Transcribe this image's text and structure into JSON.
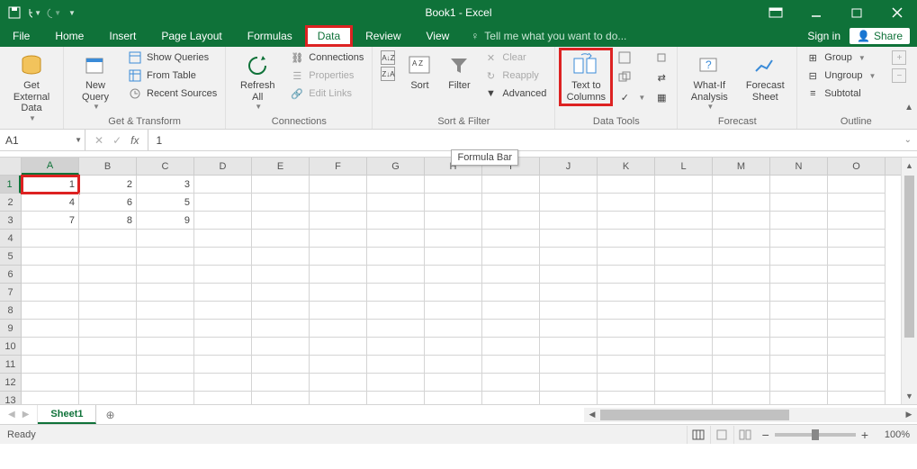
{
  "title": "Book1 - Excel",
  "tabs": [
    "File",
    "Home",
    "Insert",
    "Page Layout",
    "Formulas",
    "Data",
    "Review",
    "View"
  ],
  "active_tab": "Data",
  "tell_me": "Tell me what you want to do...",
  "sign_in": "Sign in",
  "share": "Share",
  "ribbon": {
    "get_external": {
      "label": "Get External\nData",
      "group": ""
    },
    "get_transform": {
      "new_query": "New\nQuery",
      "show_queries": "Show Queries",
      "from_table": "From Table",
      "recent_sources": "Recent Sources",
      "group": "Get & Transform"
    },
    "connections": {
      "refresh_all": "Refresh\nAll",
      "connections": "Connections",
      "properties": "Properties",
      "edit_links": "Edit Links",
      "group": "Connections"
    },
    "sort_filter": {
      "sort": "Sort",
      "filter": "Filter",
      "clear": "Clear",
      "reapply": "Reapply",
      "advanced": "Advanced",
      "group": "Sort & Filter"
    },
    "data_tools": {
      "text_to_columns": "Text to\nColumns",
      "group": "Data Tools"
    },
    "forecast": {
      "what_if": "What-If\nAnalysis",
      "forecast_sheet": "Forecast\nSheet",
      "group": "Forecast"
    },
    "outline": {
      "group_btn": "Group",
      "ungroup": "Ungroup",
      "subtotal": "Subtotal",
      "group": "Outline"
    }
  },
  "namebox": "A1",
  "formula": "1",
  "tooltip": "Formula Bar",
  "columns": [
    "A",
    "B",
    "C",
    "D",
    "E",
    "F",
    "G",
    "H",
    "I",
    "J",
    "K",
    "L",
    "M",
    "N",
    "O"
  ],
  "rows": [
    "1",
    "2",
    "3",
    "4",
    "5",
    "6",
    "7",
    "8",
    "9",
    "10",
    "11",
    "12",
    "13"
  ],
  "cells": [
    [
      "1",
      "2",
      "3",
      "",
      "",
      "",
      "",
      "",
      "",
      "",
      "",
      "",
      "",
      "",
      ""
    ],
    [
      "4",
      "6",
      "5",
      "",
      "",
      "",
      "",
      "",
      "",
      "",
      "",
      "",
      "",
      "",
      ""
    ],
    [
      "7",
      "8",
      "9",
      "",
      "",
      "",
      "",
      "",
      "",
      "",
      "",
      "",
      "",
      "",
      ""
    ]
  ],
  "active_cell": {
    "row": 0,
    "col": 0
  },
  "sheet_tab": "Sheet1",
  "status": "Ready",
  "zoom": "100%",
  "chart_data": {
    "type": "table",
    "columns": [
      "A",
      "B",
      "C"
    ],
    "rows": [
      [
        1,
        2,
        3
      ],
      [
        4,
        6,
        5
      ],
      [
        7,
        8,
        9
      ]
    ]
  }
}
